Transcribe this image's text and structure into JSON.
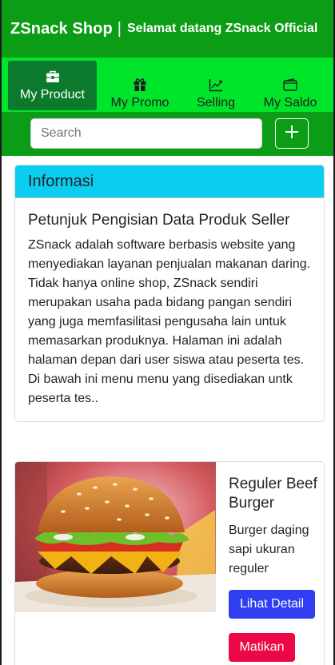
{
  "header": {
    "brand": "ZSnack Shop",
    "separator": "|",
    "welcome": "Selamat datang ZSnack Official"
  },
  "tabs": [
    {
      "label": "My Product",
      "icon": "toolbox-icon",
      "active": true
    },
    {
      "label": "My Promo",
      "icon": "gift-icon",
      "active": false
    },
    {
      "label": "Selling",
      "icon": "chart-line-icon",
      "active": false
    },
    {
      "label": "My Saldo",
      "icon": "wallet-icon",
      "active": false
    }
  ],
  "search": {
    "placeholder": "Search",
    "add_icon": "plus-icon"
  },
  "info": {
    "header": "Informasi",
    "title": "Petunjuk Pengisian Data Produk Seller",
    "text": "ZSnack adalah software berbasis website yang menyediakan layanan penjualan makanan daring. Tidak hanya online shop, ZSnack sendiri merupakan usaha pada bidang pangan sendiri yang juga memfasilitasi pengusaha lain untuk memasarkan produknya. Halaman ini adalah halaman depan dari user siswa atau peserta tes. Di bawah ini menu menu yang disediakan untk peserta tes.."
  },
  "product": {
    "name": "Reguler Beef Burger",
    "description": "Burger daging sapi ukuran reguler",
    "detail_label": "Lihat Detail",
    "disable_label": "Matikan"
  },
  "colors": {
    "header_green": "#0b9d16",
    "tab_green": "#00e52a",
    "active_tab": "#0b7a2c",
    "info_header": "#0bcdef",
    "detail_button": "#2f3ef0",
    "disable_button": "#ec0845"
  }
}
